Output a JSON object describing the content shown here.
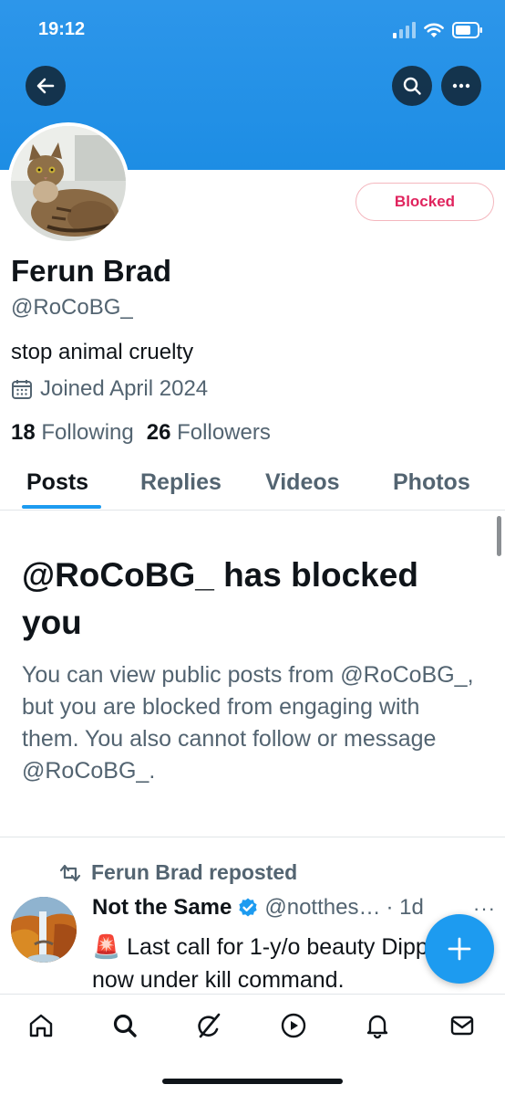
{
  "status_bar": {
    "time": "19:12"
  },
  "profile": {
    "name": "Ferun Brad",
    "handle": "@RoCoBG_",
    "bio": "stop animal cruelty",
    "joined": "Joined April 2024",
    "following_count": "18",
    "following_label": "Following",
    "followers_count": "26",
    "followers_label": "Followers",
    "blocked_label": "Blocked"
  },
  "tabs": [
    {
      "label": "Posts",
      "active": true
    },
    {
      "label": "Replies",
      "active": false
    },
    {
      "label": "Videos",
      "active": false
    },
    {
      "label": "Photos",
      "active": false
    }
  ],
  "blocked_notice": {
    "title": "@RoCoBG_ has blocked you",
    "description": "You can view public posts from @RoCoBG_, but you are blocked from engaging with them. You also cannot follow or message @RoCoBG_."
  },
  "post": {
    "repost_label": "Ferun Brad reposted",
    "author": "Not the Same",
    "handle": "@notthes…",
    "time": "· 1d",
    "more": "···",
    "text": "🚨 Last call for 1-y/o beauty Dipper, now under kill command."
  },
  "icons": {
    "back": "back-arrow-icon",
    "search": "search-icon",
    "more": "more-icon",
    "calendar": "calendar-icon",
    "repost": "repost-icon",
    "verified": "verified-badge-icon",
    "compose": "plus-icon",
    "nav": [
      "home-icon",
      "search-icon",
      "grok-icon",
      "play-icon",
      "bell-icon",
      "mail-icon"
    ]
  },
  "colors": {
    "accent": "#1d9bf0",
    "blocked": "#e0245e",
    "banner": "#1d8de4",
    "secondary_text": "#536471"
  }
}
